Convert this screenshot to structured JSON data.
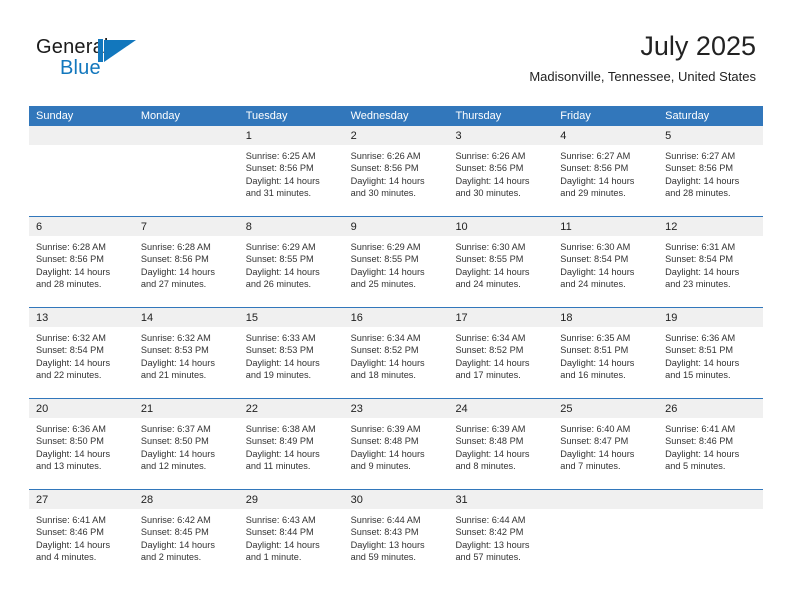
{
  "brand": {
    "word_general": "General",
    "word_blue": "Blue",
    "logo_color": "#1277bd"
  },
  "header": {
    "title": "July 2025",
    "subtitle": "Madisonville, Tennessee, United States"
  },
  "theme": {
    "header_bar": "#3277bb",
    "daynum_band": "#f0f0f0",
    "text": "#222222"
  },
  "calendar": {
    "weekdays": [
      "Sunday",
      "Monday",
      "Tuesday",
      "Wednesday",
      "Thursday",
      "Friday",
      "Saturday"
    ],
    "weeks": [
      [
        {
          "day": "",
          "sunrise": "",
          "sunset": "",
          "daylight_1": "",
          "daylight_2": ""
        },
        {
          "day": "",
          "sunrise": "",
          "sunset": "",
          "daylight_1": "",
          "daylight_2": ""
        },
        {
          "day": "1",
          "sunrise": "Sunrise: 6:25 AM",
          "sunset": "Sunset: 8:56 PM",
          "daylight_1": "Daylight: 14 hours",
          "daylight_2": "and 31 minutes."
        },
        {
          "day": "2",
          "sunrise": "Sunrise: 6:26 AM",
          "sunset": "Sunset: 8:56 PM",
          "daylight_1": "Daylight: 14 hours",
          "daylight_2": "and 30 minutes."
        },
        {
          "day": "3",
          "sunrise": "Sunrise: 6:26 AM",
          "sunset": "Sunset: 8:56 PM",
          "daylight_1": "Daylight: 14 hours",
          "daylight_2": "and 30 minutes."
        },
        {
          "day": "4",
          "sunrise": "Sunrise: 6:27 AM",
          "sunset": "Sunset: 8:56 PM",
          "daylight_1": "Daylight: 14 hours",
          "daylight_2": "and 29 minutes."
        },
        {
          "day": "5",
          "sunrise": "Sunrise: 6:27 AM",
          "sunset": "Sunset: 8:56 PM",
          "daylight_1": "Daylight: 14 hours",
          "daylight_2": "and 28 minutes."
        }
      ],
      [
        {
          "day": "6",
          "sunrise": "Sunrise: 6:28 AM",
          "sunset": "Sunset: 8:56 PM",
          "daylight_1": "Daylight: 14 hours",
          "daylight_2": "and 28 minutes."
        },
        {
          "day": "7",
          "sunrise": "Sunrise: 6:28 AM",
          "sunset": "Sunset: 8:56 PM",
          "daylight_1": "Daylight: 14 hours",
          "daylight_2": "and 27 minutes."
        },
        {
          "day": "8",
          "sunrise": "Sunrise: 6:29 AM",
          "sunset": "Sunset: 8:55 PM",
          "daylight_1": "Daylight: 14 hours",
          "daylight_2": "and 26 minutes."
        },
        {
          "day": "9",
          "sunrise": "Sunrise: 6:29 AM",
          "sunset": "Sunset: 8:55 PM",
          "daylight_1": "Daylight: 14 hours",
          "daylight_2": "and 25 minutes."
        },
        {
          "day": "10",
          "sunrise": "Sunrise: 6:30 AM",
          "sunset": "Sunset: 8:55 PM",
          "daylight_1": "Daylight: 14 hours",
          "daylight_2": "and 24 minutes."
        },
        {
          "day": "11",
          "sunrise": "Sunrise: 6:30 AM",
          "sunset": "Sunset: 8:54 PM",
          "daylight_1": "Daylight: 14 hours",
          "daylight_2": "and 24 minutes."
        },
        {
          "day": "12",
          "sunrise": "Sunrise: 6:31 AM",
          "sunset": "Sunset: 8:54 PM",
          "daylight_1": "Daylight: 14 hours",
          "daylight_2": "and 23 minutes."
        }
      ],
      [
        {
          "day": "13",
          "sunrise": "Sunrise: 6:32 AM",
          "sunset": "Sunset: 8:54 PM",
          "daylight_1": "Daylight: 14 hours",
          "daylight_2": "and 22 minutes."
        },
        {
          "day": "14",
          "sunrise": "Sunrise: 6:32 AM",
          "sunset": "Sunset: 8:53 PM",
          "daylight_1": "Daylight: 14 hours",
          "daylight_2": "and 21 minutes."
        },
        {
          "day": "15",
          "sunrise": "Sunrise: 6:33 AM",
          "sunset": "Sunset: 8:53 PM",
          "daylight_1": "Daylight: 14 hours",
          "daylight_2": "and 19 minutes."
        },
        {
          "day": "16",
          "sunrise": "Sunrise: 6:34 AM",
          "sunset": "Sunset: 8:52 PM",
          "daylight_1": "Daylight: 14 hours",
          "daylight_2": "and 18 minutes."
        },
        {
          "day": "17",
          "sunrise": "Sunrise: 6:34 AM",
          "sunset": "Sunset: 8:52 PM",
          "daylight_1": "Daylight: 14 hours",
          "daylight_2": "and 17 minutes."
        },
        {
          "day": "18",
          "sunrise": "Sunrise: 6:35 AM",
          "sunset": "Sunset: 8:51 PM",
          "daylight_1": "Daylight: 14 hours",
          "daylight_2": "and 16 minutes."
        },
        {
          "day": "19",
          "sunrise": "Sunrise: 6:36 AM",
          "sunset": "Sunset: 8:51 PM",
          "daylight_1": "Daylight: 14 hours",
          "daylight_2": "and 15 minutes."
        }
      ],
      [
        {
          "day": "20",
          "sunrise": "Sunrise: 6:36 AM",
          "sunset": "Sunset: 8:50 PM",
          "daylight_1": "Daylight: 14 hours",
          "daylight_2": "and 13 minutes."
        },
        {
          "day": "21",
          "sunrise": "Sunrise: 6:37 AM",
          "sunset": "Sunset: 8:50 PM",
          "daylight_1": "Daylight: 14 hours",
          "daylight_2": "and 12 minutes."
        },
        {
          "day": "22",
          "sunrise": "Sunrise: 6:38 AM",
          "sunset": "Sunset: 8:49 PM",
          "daylight_1": "Daylight: 14 hours",
          "daylight_2": "and 11 minutes."
        },
        {
          "day": "23",
          "sunrise": "Sunrise: 6:39 AM",
          "sunset": "Sunset: 8:48 PM",
          "daylight_1": "Daylight: 14 hours",
          "daylight_2": "and 9 minutes."
        },
        {
          "day": "24",
          "sunrise": "Sunrise: 6:39 AM",
          "sunset": "Sunset: 8:48 PM",
          "daylight_1": "Daylight: 14 hours",
          "daylight_2": "and 8 minutes."
        },
        {
          "day": "25",
          "sunrise": "Sunrise: 6:40 AM",
          "sunset": "Sunset: 8:47 PM",
          "daylight_1": "Daylight: 14 hours",
          "daylight_2": "and 7 minutes."
        },
        {
          "day": "26",
          "sunrise": "Sunrise: 6:41 AM",
          "sunset": "Sunset: 8:46 PM",
          "daylight_1": "Daylight: 14 hours",
          "daylight_2": "and 5 minutes."
        }
      ],
      [
        {
          "day": "27",
          "sunrise": "Sunrise: 6:41 AM",
          "sunset": "Sunset: 8:46 PM",
          "daylight_1": "Daylight: 14 hours",
          "daylight_2": "and 4 minutes."
        },
        {
          "day": "28",
          "sunrise": "Sunrise: 6:42 AM",
          "sunset": "Sunset: 8:45 PM",
          "daylight_1": "Daylight: 14 hours",
          "daylight_2": "and 2 minutes."
        },
        {
          "day": "29",
          "sunrise": "Sunrise: 6:43 AM",
          "sunset": "Sunset: 8:44 PM",
          "daylight_1": "Daylight: 14 hours",
          "daylight_2": "and 1 minute."
        },
        {
          "day": "30",
          "sunrise": "Sunrise: 6:44 AM",
          "sunset": "Sunset: 8:43 PM",
          "daylight_1": "Daylight: 13 hours",
          "daylight_2": "and 59 minutes."
        },
        {
          "day": "31",
          "sunrise": "Sunrise: 6:44 AM",
          "sunset": "Sunset: 8:42 PM",
          "daylight_1": "Daylight: 13 hours",
          "daylight_2": "and 57 minutes."
        },
        {
          "day": "",
          "sunrise": "",
          "sunset": "",
          "daylight_1": "",
          "daylight_2": ""
        },
        {
          "day": "",
          "sunrise": "",
          "sunset": "",
          "daylight_1": "",
          "daylight_2": ""
        }
      ]
    ]
  }
}
